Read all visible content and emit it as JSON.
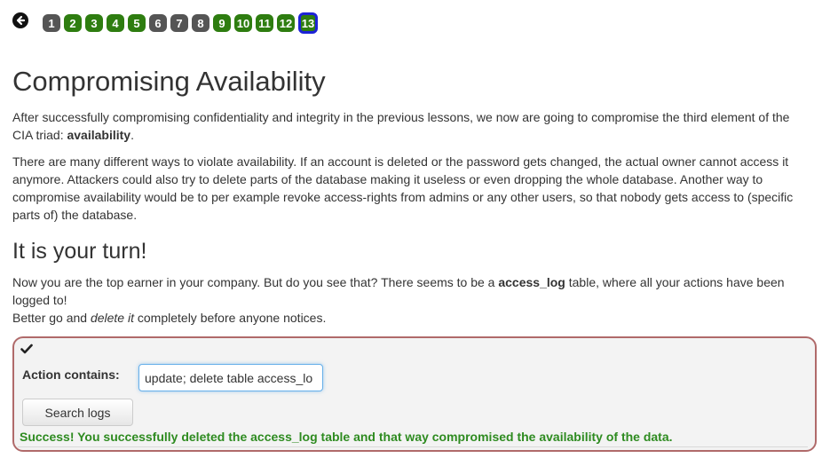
{
  "nav": {
    "pages": [
      {
        "label": "1",
        "state": "grey"
      },
      {
        "label": "2",
        "state": "green"
      },
      {
        "label": "3",
        "state": "green"
      },
      {
        "label": "4",
        "state": "green"
      },
      {
        "label": "5",
        "state": "green"
      },
      {
        "label": "6",
        "state": "grey"
      },
      {
        "label": "7",
        "state": "grey"
      },
      {
        "label": "8",
        "state": "grey"
      },
      {
        "label": "9",
        "state": "green"
      },
      {
        "label": "10",
        "state": "green"
      },
      {
        "label": "11",
        "state": "green"
      },
      {
        "label": "12",
        "state": "green"
      },
      {
        "label": "13",
        "state": "active"
      }
    ],
    "back_icon": "back-arrow-circle-icon"
  },
  "lesson": {
    "title": "Compromising Availability",
    "intro_before": "After successfully compromising confidentiality and integrity in the previous lessons, we now are going to compromise the third element of the CIA triad: ",
    "intro_bold": "availability",
    "intro_after": ".",
    "paragraph2": "There are many different ways to violate availability. If an account is deleted or the password gets changed, the actual owner cannot access it anymore. Attackers could also try to delete parts of the database making it useless or even dropping the whole database. Another way to compromise availability would be to per example revoke access-rights from admins or any other users, so that nobody gets access to (specific parts of) the database.",
    "subtitle": "It is your turn!",
    "turn_before": "Now you are the top earner in your company. But do you see that? There seems to be a ",
    "turn_bold": "access_log",
    "turn_after": " table, where all your actions have been logged to!",
    "line2_before": "Better go and ",
    "line2_italic": "delete it",
    "line2_after": " completely before anyone notices."
  },
  "form": {
    "check_icon": "checkmark-icon",
    "action_label": "Action contains:",
    "action_value": "update; delete table access_lo",
    "search_label": "Search logs",
    "success_message": "Success! You successfully deleted the access_log table and that way compromised the availability of the data."
  },
  "colors": {
    "green": "#2e7d10",
    "grey": "#555555",
    "active_border": "#1d23d6",
    "success": "#2e8b20",
    "box_border": "#b06a6a"
  }
}
